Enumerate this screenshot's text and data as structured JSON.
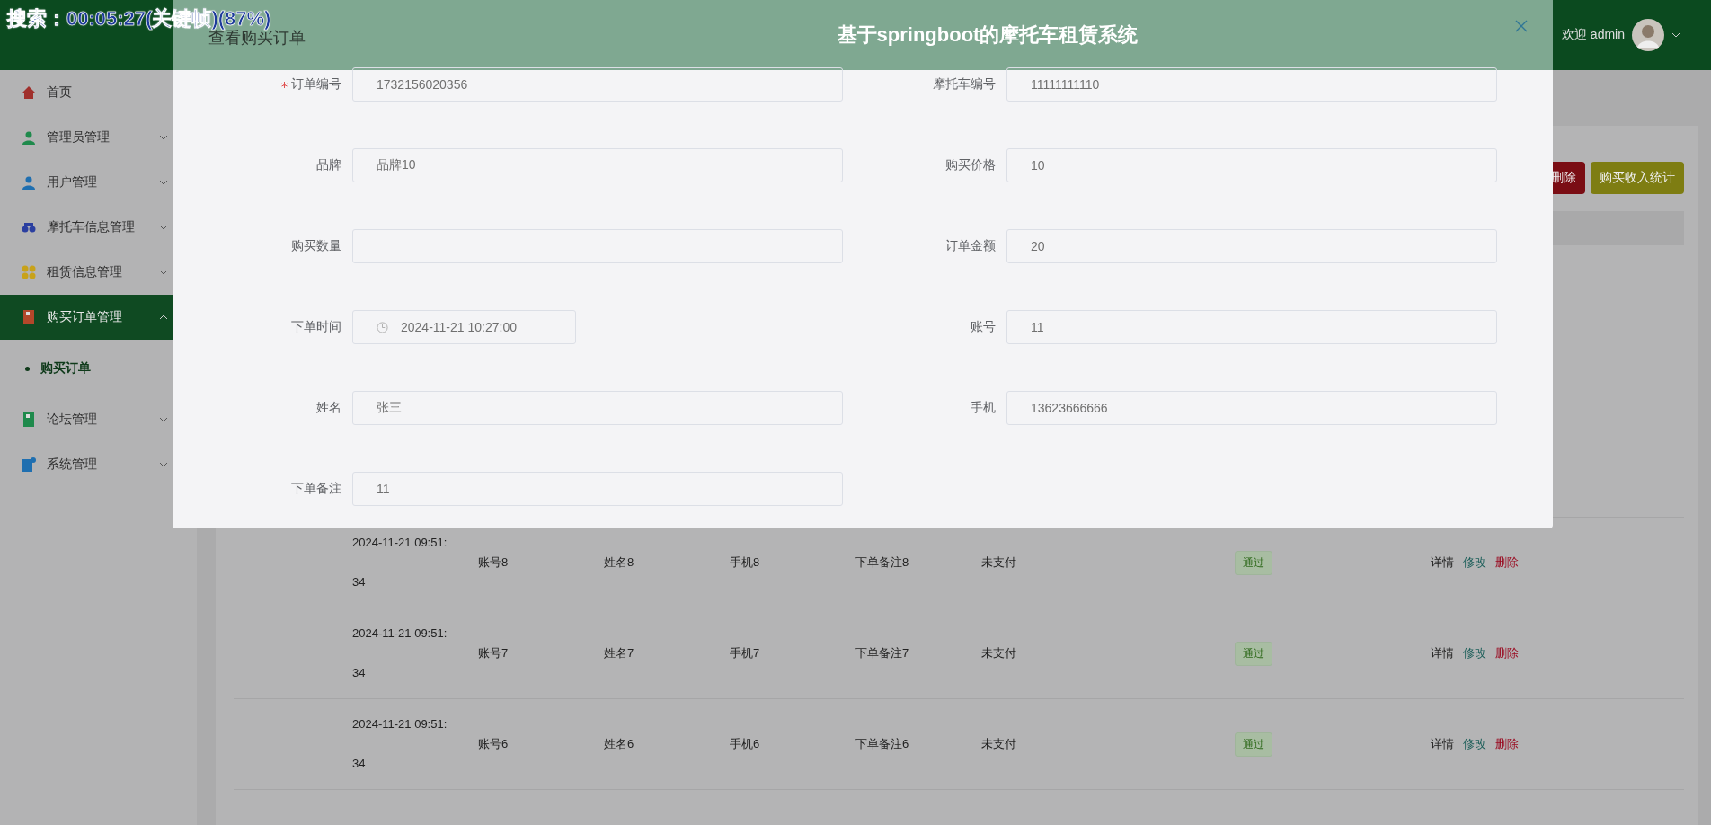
{
  "osd_text": "搜索：00:05:27(关键帧)(87%)",
  "header": {
    "title": "基于springboot的摩托车租赁系统",
    "greeting": "欢迎 admin"
  },
  "sidebar": {
    "items": [
      {
        "kind": "link",
        "label": "首页",
        "selected": false,
        "color": "#a0302c"
      },
      {
        "kind": "menu",
        "label": "管理员管理",
        "selected": false,
        "expanded": false,
        "color": "#1f8a4c"
      },
      {
        "kind": "menu",
        "label": "用户管理",
        "selected": false,
        "expanded": false,
        "color": "#1f6fb0"
      },
      {
        "kind": "menu",
        "label": "摩托车信息管理",
        "selected": false,
        "expanded": false,
        "color": "#2b3fa0"
      },
      {
        "kind": "menu",
        "label": "租赁信息管理",
        "selected": false,
        "expanded": false,
        "color": "#c8a21a"
      },
      {
        "kind": "menu",
        "label": "购买订单管理",
        "selected": true,
        "expanded": true,
        "color": "#b3472a",
        "children": [
          {
            "label": "购买订单",
            "selected": true
          }
        ]
      },
      {
        "kind": "menu",
        "label": "论坛管理",
        "selected": false,
        "expanded": false,
        "color": "#1f8a4c"
      },
      {
        "kind": "menu",
        "label": "系统管理",
        "selected": false,
        "expanded": false,
        "color": "#1f6fb0"
      }
    ]
  },
  "toolbar": {
    "buttons": [
      {
        "kind": "delete",
        "label": "删除"
      },
      {
        "kind": "stats",
        "label": "购买收入统计"
      }
    ]
  },
  "table": {
    "rows": [
      {
        "order_time": "2024-11-21 09:51:34",
        "account": "账号8",
        "name": "姓名8",
        "phone": "手机8",
        "note": "下单备注8",
        "pay_status": "未支付",
        "review_status": "通过",
        "actions": [
          "详情",
          "修改",
          "删除"
        ]
      },
      {
        "order_time": "2024-11-21 09:51:34",
        "account": "账号7",
        "name": "姓名7",
        "phone": "手机7",
        "note": "下单备注7",
        "pay_status": "未支付",
        "review_status": "通过",
        "actions": [
          "详情",
          "修改",
          "删除"
        ]
      },
      {
        "order_time": "2024-11-21 09:51:34",
        "account": "账号6",
        "name": "姓名6",
        "phone": "手机6",
        "note": "下单备注6",
        "pay_status": "未支付",
        "review_status": "通过",
        "actions": [
          "详情",
          "修改",
          "删除"
        ]
      }
    ]
  },
  "modal": {
    "title": "查看购买订单",
    "fields": [
      {
        "kind": "text",
        "label": "订单编号",
        "required": true,
        "value": "1732156020356"
      },
      {
        "kind": "text",
        "label": "摩托车编号",
        "required": false,
        "value": "11111111110"
      },
      {
        "kind": "text",
        "label": "品牌",
        "required": false,
        "value": "品牌10"
      },
      {
        "kind": "text",
        "label": "购买价格",
        "required": false,
        "value": "10"
      },
      {
        "kind": "text",
        "label": "购买数量",
        "required": false
      },
      {
        "kind": "text",
        "label": "订单金额",
        "required": false,
        "value": "20"
      },
      {
        "kind": "date",
        "label": "下单时间",
        "required": false,
        "value": "2024-11-21 10:27:00"
      },
      {
        "kind": "text",
        "label": "账号",
        "required": false,
        "value": "11"
      },
      {
        "kind": "text",
        "label": "姓名",
        "required": false,
        "value": "张三"
      },
      {
        "kind": "text",
        "label": "手机",
        "required": false,
        "value": "13623666666"
      },
      {
        "kind": "text",
        "label": "下单备注",
        "required": false,
        "value": "11"
      }
    ]
  }
}
